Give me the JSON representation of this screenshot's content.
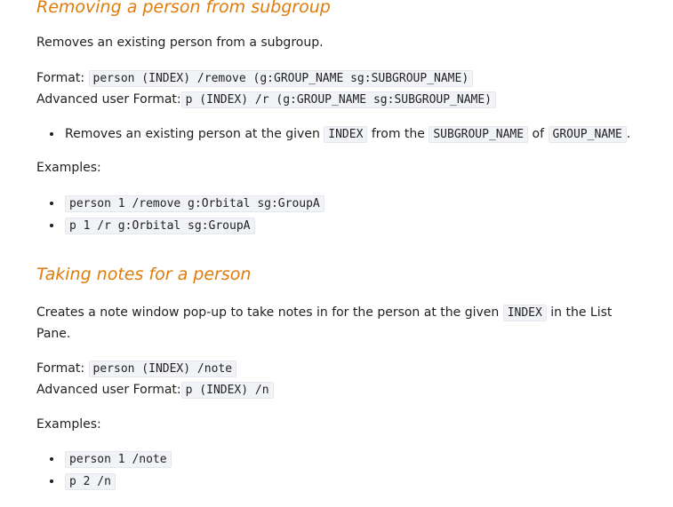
{
  "section1": {
    "heading": "Removing a person from subgroup",
    "description": "Removes an existing person from a subgroup.",
    "format_label": "Format:",
    "format_code": "person (INDEX) /remove (g:GROUP_NAME sg:SUBGROUP_NAME)",
    "adv_format_label": "Advanced user Format:",
    "adv_format_code": "p (INDEX) /r (g:GROUP_NAME sg:SUBGROUP_NAME)",
    "bullet": {
      "text1": "Removes an existing person at the given",
      "code1": "INDEX",
      "text2": "from the",
      "code2": "SUBGROUP_NAME",
      "text3": "of",
      "code3": "GROUP_NAME",
      "text4": "."
    },
    "examples_label": "Examples:",
    "examples": [
      "person 1 /remove g:Orbital sg:GroupA",
      "p 1 /r g:Orbital sg:GroupA"
    ]
  },
  "section2": {
    "heading": "Taking notes for a person",
    "description_part1": "Creates a note window pop-up to take notes in for the person at the given",
    "description_code": "INDEX",
    "description_part2": "in the List",
    "description_part3": "Pane.",
    "format_label": "Format:",
    "format_code": "person (INDEX) /note",
    "adv_format_label": "Advanced user Format:",
    "adv_format_code": "p (INDEX) /n",
    "examples_label": "Examples:",
    "examples": [
      "person 1 /note",
      "p 2 /n"
    ]
  }
}
